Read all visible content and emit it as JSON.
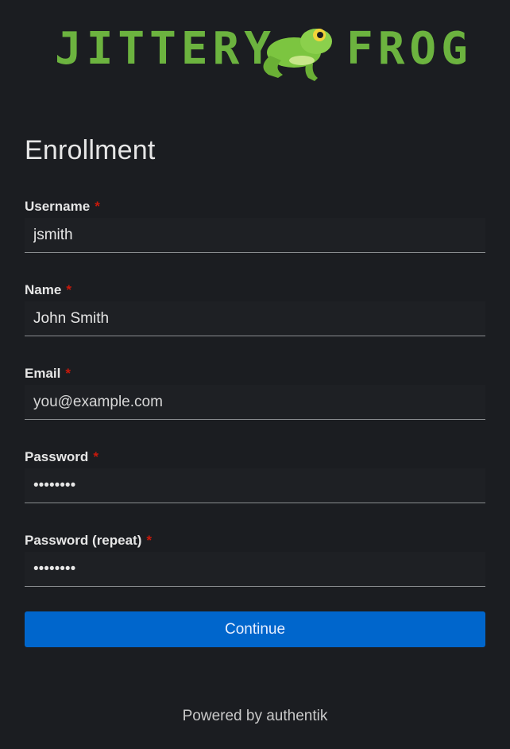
{
  "brand": {
    "left_text": "JITTERY",
    "right_text": "FROG",
    "text_color": "#6cb33f",
    "frog_color": "#7cc540"
  },
  "page": {
    "title": "Enrollment"
  },
  "fields": [
    {
      "label": "Username",
      "required_mark": "*",
      "value": "jsmith",
      "placeholder": ""
    },
    {
      "label": "Name",
      "required_mark": "*",
      "value": "John Smith",
      "placeholder": ""
    },
    {
      "label": "Email",
      "required_mark": "*",
      "value": "",
      "placeholder": "you@example.com"
    },
    {
      "label": "Password",
      "required_mark": "*",
      "value": "........",
      "placeholder": ""
    },
    {
      "label": "Password (repeat)",
      "required_mark": "*",
      "value": "........",
      "placeholder": ""
    }
  ],
  "actions": {
    "continue_label": "Continue"
  },
  "footer": {
    "text": "Powered by authentik"
  },
  "colors": {
    "background": "#1b1d21",
    "primary": "#0066cc",
    "required": "#c9190b"
  }
}
